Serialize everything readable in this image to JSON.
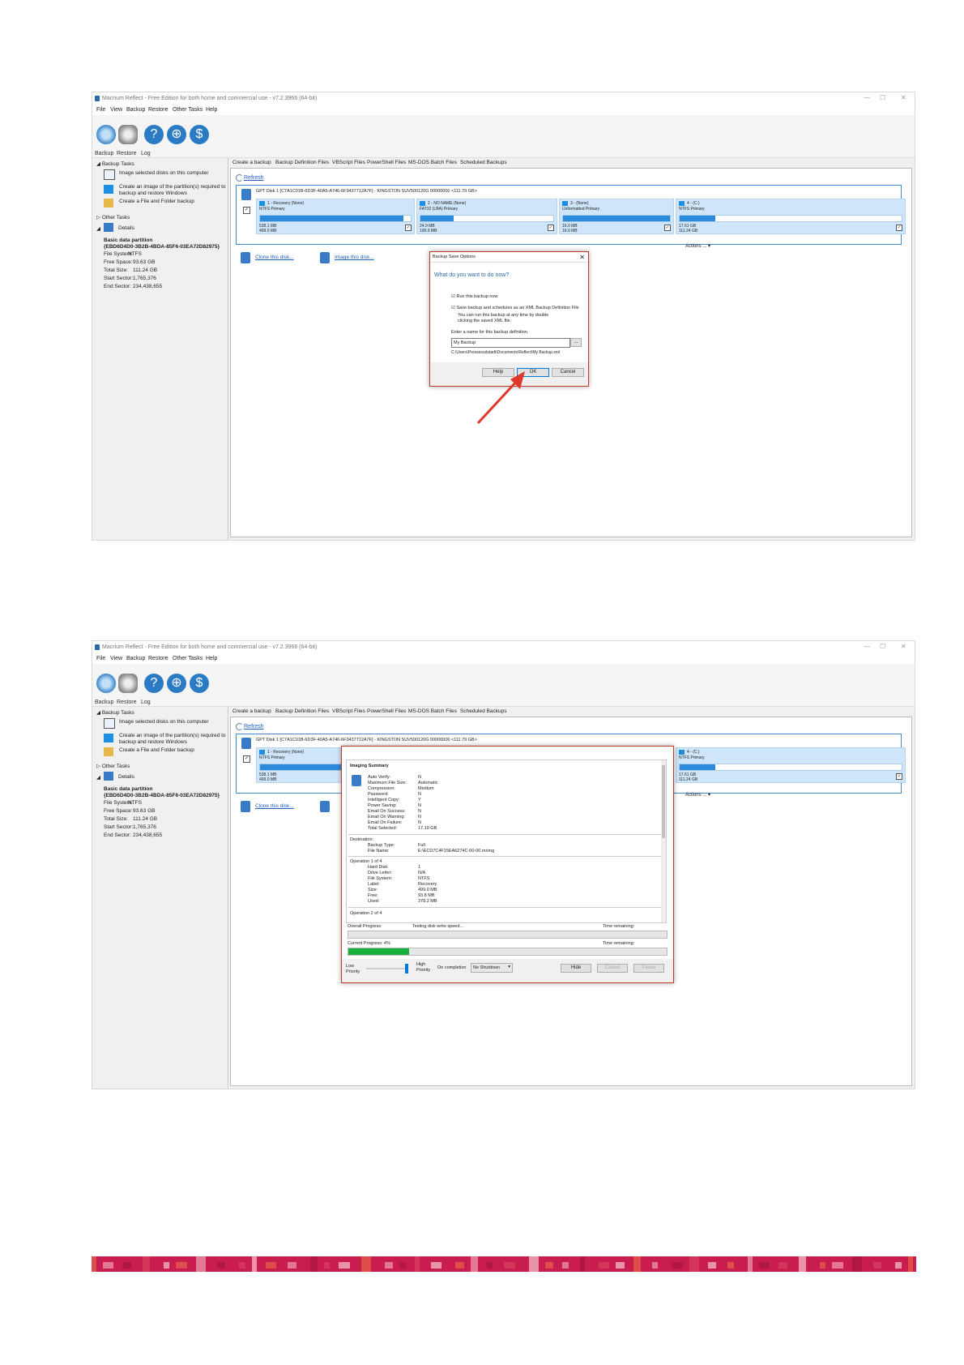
{
  "app": {
    "title": "Macrium Reflect - Free Edition for both home and commercial use - v7.2.3966 (64-bit)",
    "menu": [
      "File",
      "View",
      "Backup",
      "Restore",
      "Other Tasks",
      "Help"
    ],
    "toolbar_labels": [
      "Backup",
      "Restore",
      "Log"
    ],
    "window_controls": [
      "—",
      "☐",
      "✕"
    ]
  },
  "left_panel": {
    "backup_tasks": "Backup Tasks",
    "task1": "Image selected disks on this computer",
    "task2a": "Create an image of the partition(s) required to",
    "task2b": "backup and restore Windows",
    "task3": "Create a File and Folder backup",
    "other_tasks": "Other Tasks",
    "details": "Details",
    "partition_title": "Basic data partition",
    "partition_guid": "{EBD6D4D0-3B2B-4BDA-85F6-03EA72D82975}",
    "fs_label": "File System:",
    "fs_value": "NTFS",
    "free_label": "Free Space:",
    "free_value": "93.63 GB",
    "total_label": "Total Size:",
    "total_value": "111.24 GB",
    "start_label": "Start Sector:",
    "start_value": "1,765,376",
    "end_label": "End Sector:",
    "end_value": "234,438,655"
  },
  "tabs": [
    "Create a backup",
    "Backup Definition Files",
    "VBScript Files",
    "PowerShell Files",
    "MS-DOS Batch Files",
    "Scheduled Backups"
  ],
  "refresh": "Refresh",
  "disk": {
    "title": "GPT Disk 1 [C7A1C01B-6D3F-40A5-A746-6F3437712A7F] - KINGSTON SUV500120G 00000000 <111.79 GB>",
    "partitions": [
      {
        "name": "1 - Recovery (None)",
        "fs": "NTFS Primary",
        "used": "538.1 MB",
        "size": "499.0 MB",
        "fill": 0.95
      },
      {
        "name": "2 - NO NAME (None)",
        "fs": "FAT32 (LBA) Primary",
        "used": "24.9 MB",
        "size": "100.0 MB",
        "fill": 0.25
      },
      {
        "name": "3 - (None)",
        "fs": "Unformatted Primary",
        "used": "16.0 MB",
        "size": "16.0 MB",
        "fill": 1.0
      },
      {
        "name": "4 - (C:)",
        "fs": "NTFS Primary",
        "used": "17.61 GB",
        "size": "111.24 GB",
        "fill": 0.16
      }
    ],
    "actions": "Actions ..."
  },
  "links": {
    "clone": "Clone this disk...",
    "image": "Image this disk..."
  },
  "save_dialog": {
    "title": "Backup Save Options",
    "close": "✕",
    "question": "What do you want to do now?",
    "run_now": "Run this backup now",
    "save_xml": "Save backup and schedules as an XML Backup Definition File",
    "note1": "You can run this backup at any time by double",
    "note2": "clicking the saved XML file.",
    "name_label": "Enter a name for this backup definition.",
    "name_value": "My Backup",
    "browse": "...",
    "path": "C:\\Users\\Pressesudstadt\\Documents\\Reflect\\My Backup.xml",
    "help": "Help",
    "ok": "OK",
    "cancel": "Cancel"
  },
  "progress_dialog": {
    "summary_title": "Imaging Summary",
    "summary_keys": [
      "Auto Verify:",
      "Maximum File Size:",
      "Compression:",
      "Password:",
      "Intelligent Copy:",
      "Power Saving:",
      "Email On Success:",
      "Email On Warning:",
      "Email On Failure:",
      "Total Selected:"
    ],
    "summary_vals": [
      "N",
      "Automatic",
      "Medium",
      "N",
      "Y",
      "N",
      "N",
      "N",
      "N",
      "17.10 GB"
    ],
    "destination_title": "Destination:",
    "dest_keys": [
      "Backup Type:",
      "File Name:"
    ],
    "dest_vals": [
      "Full",
      "E:\\ECD7C4F15EA6274C-00-00.mrimg"
    ],
    "operation1_title": "Operation 1 of 4",
    "op_keys": [
      "Hard Disk:",
      "Drive Letter:",
      "File System:",
      "Label:",
      "Size:",
      "Free:",
      "Used:"
    ],
    "op_vals": [
      "1",
      "N/A",
      "NTFS",
      "Recovery",
      "499.0 MB",
      "93.8 MB",
      "378.2 MB"
    ],
    "operation2_title": "Operation 2 of 4",
    "overall": "Overall Progress:",
    "testing": "Testing disk write speed...",
    "time_remaining1": "Time remaining:",
    "current": "Current Progress: 4%",
    "time_remaining2": "Time remaining:",
    "current_fill": 0.19,
    "low": "Low",
    "priority": "Priority",
    "high": "High",
    "on_completion": "On completion",
    "no_shutdown": "No Shutdown",
    "hide": "Hide",
    "cancel": "Cancel",
    "pause": "Pause"
  },
  "colors": {
    "accent": "#2a8adb",
    "dialog_border": "#c0392b",
    "progress_green": "#17b03c",
    "arrow": "#e0382a"
  }
}
